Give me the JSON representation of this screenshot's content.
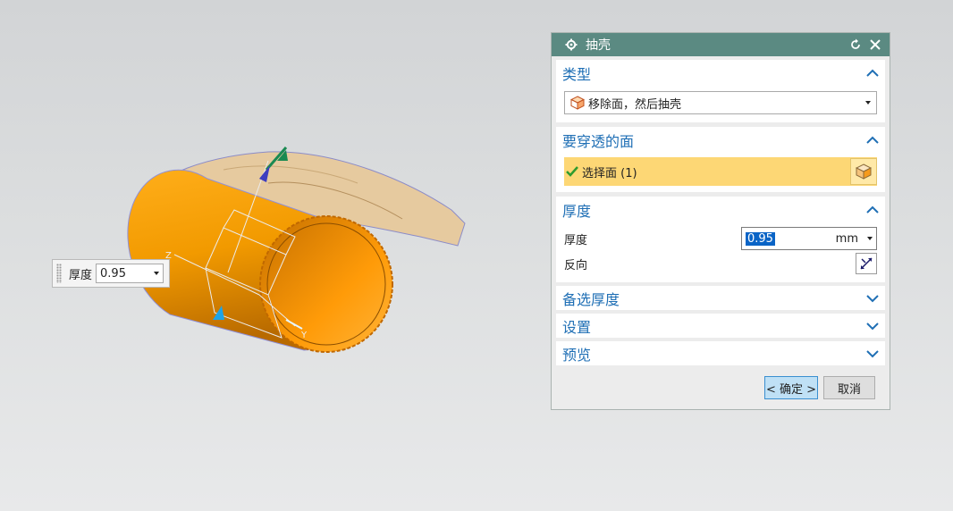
{
  "viewport": {
    "handle": {
      "label": "厚度",
      "value": "0.95"
    },
    "axis_z_label": "Z",
    "axis_y_label": "Y"
  },
  "dialog": {
    "title": "抽壳",
    "sections": {
      "type": {
        "title": "类型",
        "value": "移除面，然后抽壳"
      },
      "faces": {
        "title": "要穿透的面",
        "select_text": "选择面 (1)"
      },
      "thickness": {
        "title": "厚度",
        "thickness_label": "厚度",
        "thickness_value": "0.95",
        "unit": "mm",
        "reverse_label": "反向"
      },
      "alt_thickness": {
        "title": "备选厚度"
      },
      "settings": {
        "title": "设置"
      },
      "preview": {
        "title": "预览"
      }
    },
    "ok_label": "< 确定 >",
    "cancel_label": "取消"
  },
  "colors": {
    "title_bar": "#5b8a82",
    "section_title": "#1f6fb5",
    "selection_highlight": "#fdd775",
    "part": "#ff9e00"
  }
}
